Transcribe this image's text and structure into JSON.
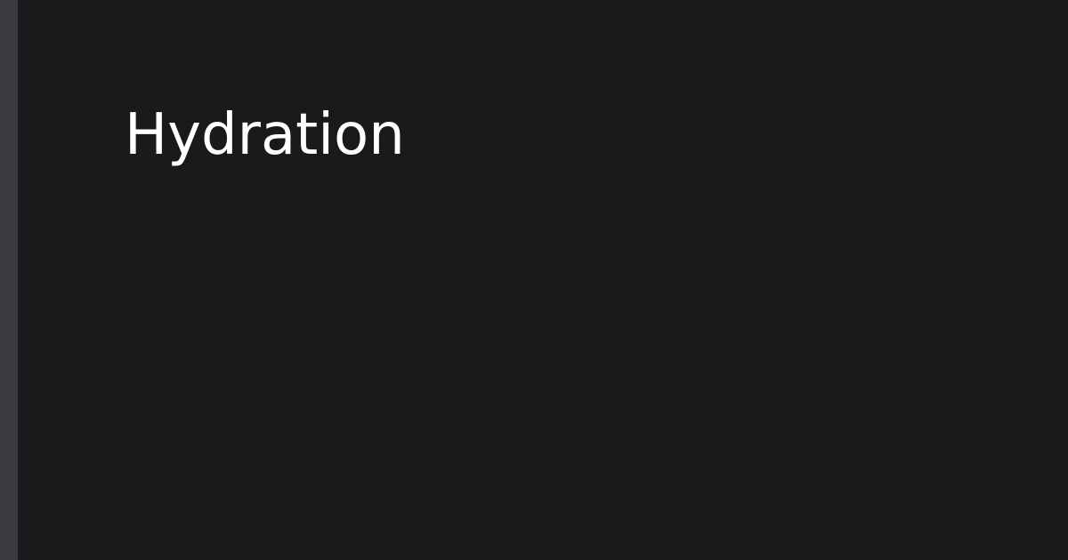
{
  "card": {
    "title": "Hydration"
  },
  "colors": {
    "background": "#1a1a1c",
    "accent_strip": "#3a3b40",
    "title_text": "#ffffff"
  }
}
